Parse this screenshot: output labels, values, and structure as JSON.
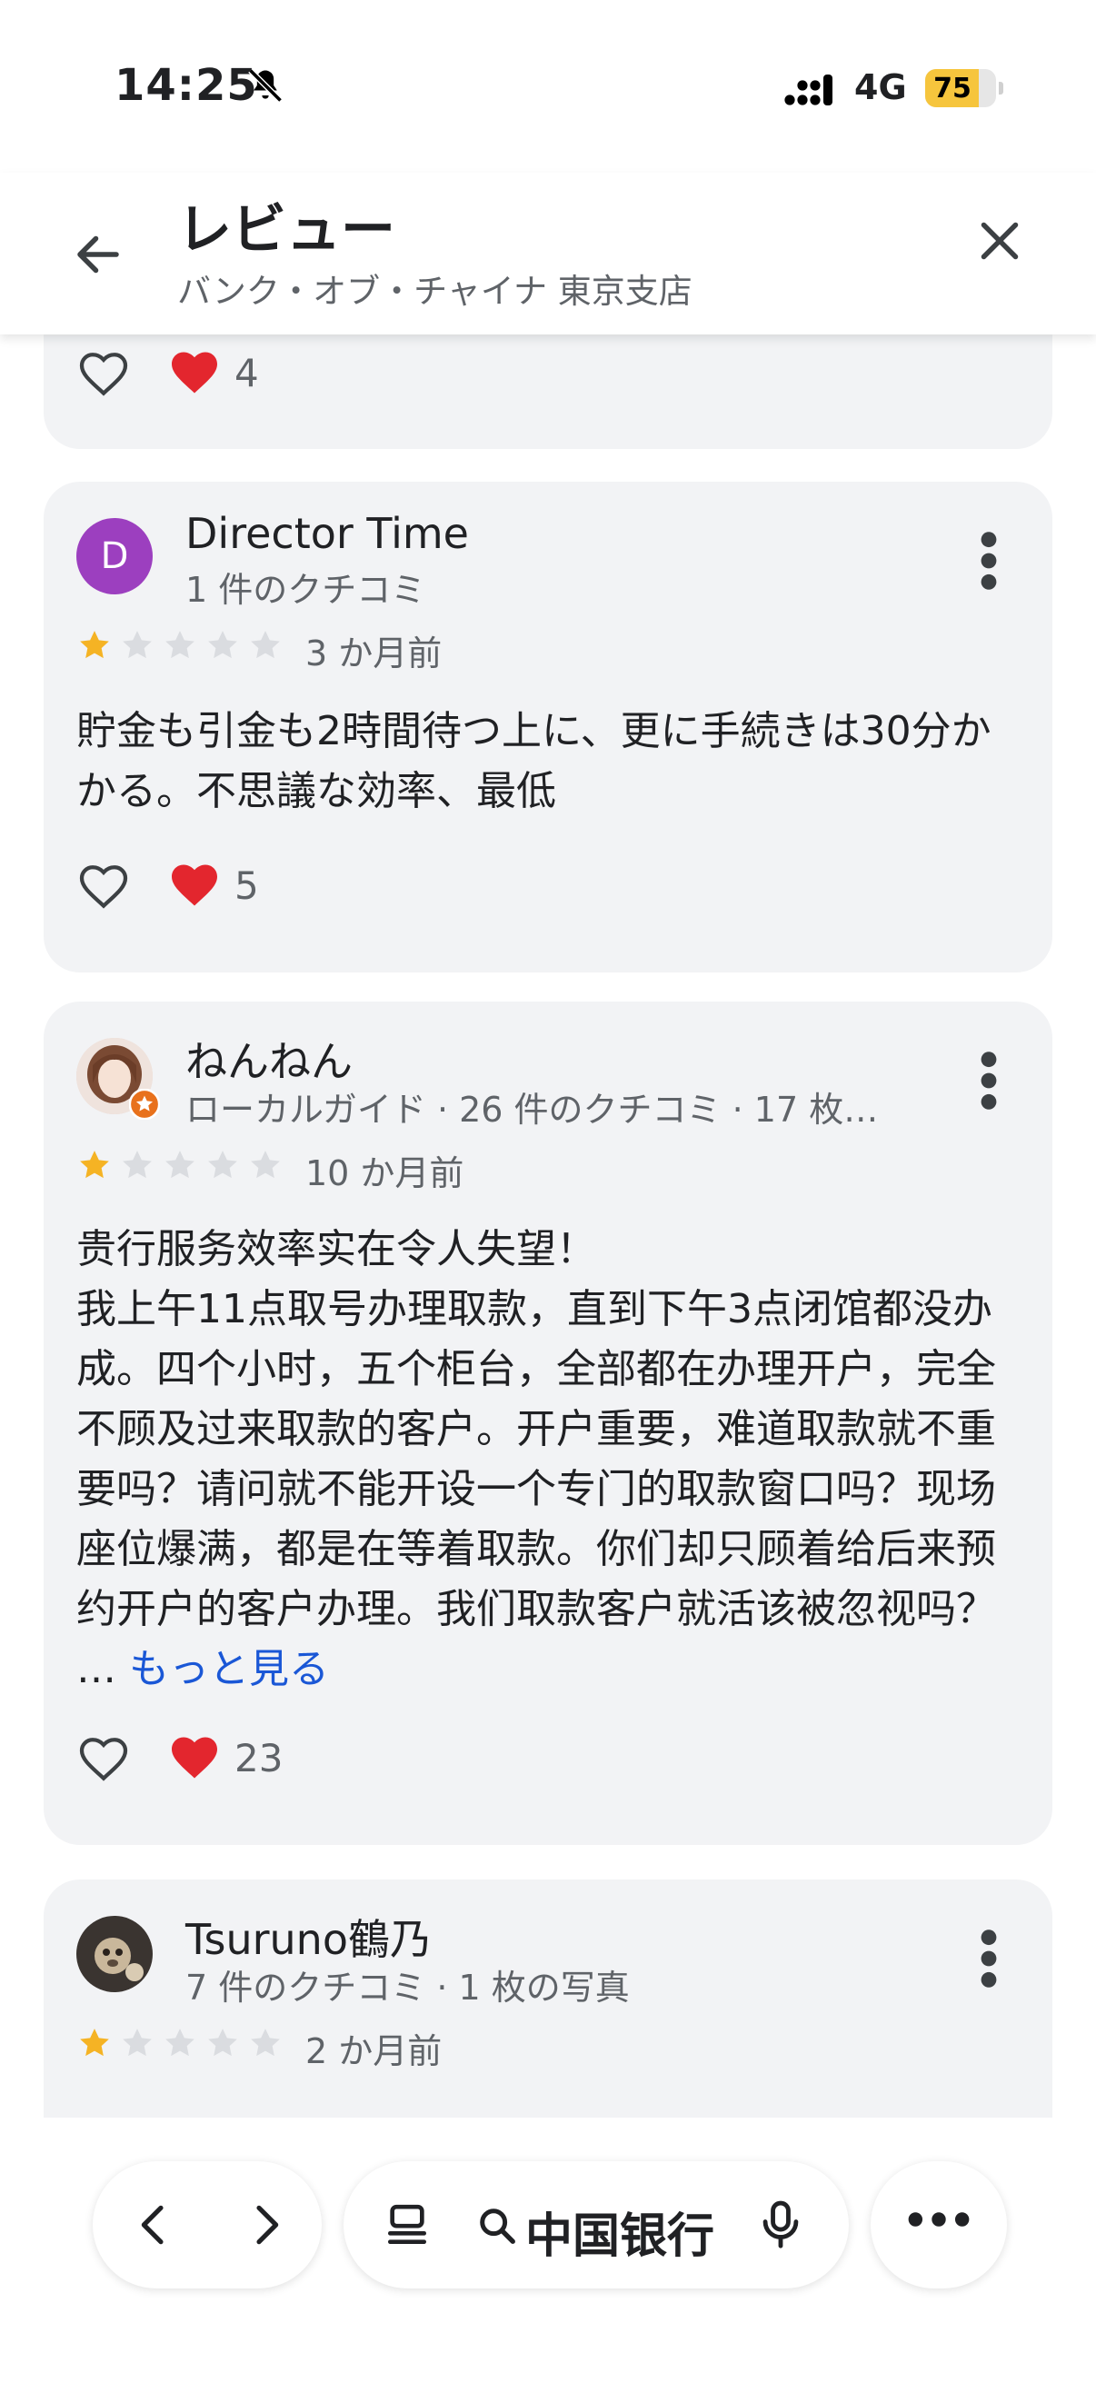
{
  "status": {
    "time": "14:25",
    "network": "4G",
    "battery": "75",
    "battery_level": 0.75
  },
  "header": {
    "title": "レビュー",
    "subtitle": "バンク・オブ・チャイナ 東京支店"
  },
  "reviews": [
    {
      "likes": "4"
    },
    {
      "initial": "D",
      "avatar_color": "#9c3fbf",
      "name": "Director Time",
      "meta": "1 件のクチコミ",
      "rating": 1,
      "time": "3 か月前",
      "text": "貯金も引金も2時間待つ上に、更に手続きは30分かかる。不思議な効率、最低",
      "likes": "5"
    },
    {
      "name": "ねんねん",
      "meta": "ローカルガイド · 26 件のクチコミ · 17 枚…",
      "rating": 1,
      "time": "10 か月前",
      "text": "贵行服务效率实在令人失望！\n我上午11点取号办理取款，直到下午3点闭馆都没办成。四个小时，五个柜台，全部都在办理开户，完全不顾及过来取款的客户。开户重要，难道取款就不重要吗？请问就不能开设一个专门的取款窗口吗？现场座位爆满，都是在等着取款。你们却只顾着给后来预约开户的客户办理。我们取款客户就活该被忽视吗？ …",
      "more_label": "もっと見る",
      "likes": "23"
    },
    {
      "name": "Tsuruno鶴乃",
      "meta": "7 件のクチコミ · 1 枚の写真",
      "rating": 1,
      "time": "2 か月前"
    }
  ],
  "bottom_bar": {
    "search_query": "中国银行"
  },
  "colors": {
    "star_filled": "#f5b324",
    "star_empty": "#dadce0",
    "link": "#1a57d6",
    "heart": "#e3262e"
  }
}
